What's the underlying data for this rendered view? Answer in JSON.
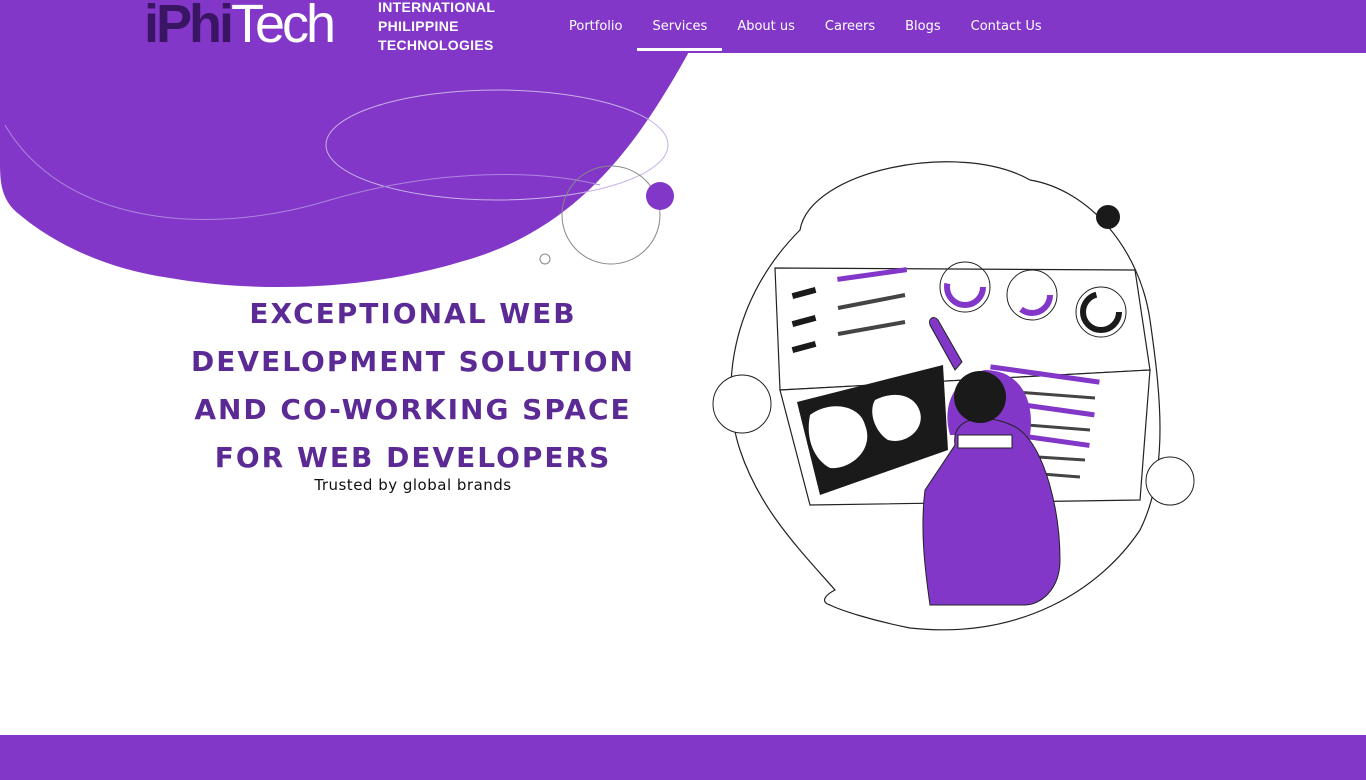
{
  "brand": {
    "logo_main_dark": "iPhi",
    "logo_main_light": "Tech",
    "logo_sub_1": "INTERNATIONAL",
    "logo_sub_2": "PHILIPPINE",
    "logo_sub_3": "TECHNOLOGIES"
  },
  "nav": {
    "items": [
      {
        "label": "Portfolio"
      },
      {
        "label": "Services"
      },
      {
        "label": "About us"
      },
      {
        "label": "Careers"
      },
      {
        "label": "Blogs"
      },
      {
        "label": "Contact Us"
      }
    ],
    "active": "Services"
  },
  "hero": {
    "headline_lines": [
      "EXCEPTIONAL WEB",
      "DEVELOPMENT SOLUTION",
      "AND CO-WORKING SPACE",
      "FOR WEB DEVELOPERS"
    ],
    "tagline": "Trusted by global brands"
  },
  "colors": {
    "brand_purple": "#8237c9",
    "headline_purple": "#5b2a94",
    "logo_dark": "#3a1563",
    "background": "#ffffff"
  },
  "icons": {
    "illustration": "developer-at-dashboard-illustration",
    "blob": "decorative-purple-blob"
  }
}
